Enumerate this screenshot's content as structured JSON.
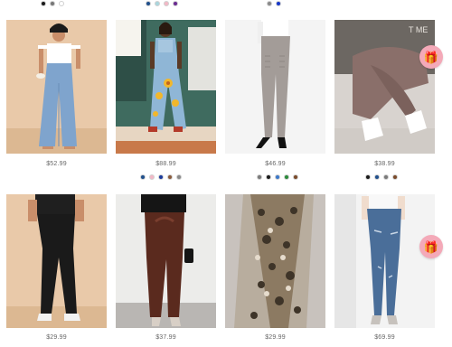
{
  "top_swatches": [
    {
      "colors": [
        "#1a1a1a",
        "#777777",
        "#ffffff"
      ]
    },
    {
      "colors": [
        "#1f4f8c",
        "#a9d6dd",
        "#f2b8c6",
        "#6a2a91"
      ]
    },
    {
      "colors": [
        "#8a8a8a",
        "#1637c9"
      ]
    }
  ],
  "products": [
    {
      "price": "$52.99",
      "swatches": []
    },
    {
      "price": "$88.99",
      "swatches": [
        "#1f4f8c",
        "#f2b8c6",
        "#1a3a9c",
        "#8a5a3a",
        "#8a8a8a"
      ]
    },
    {
      "price": "$46.99",
      "swatches": [
        "#7a7a7a",
        "#1a1a1a",
        "#3a78c9",
        "#2a8a3a",
        "#7a4a2a"
      ]
    },
    {
      "price": "$38.99",
      "swatches": [
        "#1a1a1a",
        "#1f4f8c",
        "#7a7a7a",
        "#7a4a2a"
      ]
    },
    {
      "price": "$29.99",
      "swatches": []
    },
    {
      "price": "$37.99",
      "swatches": []
    },
    {
      "price": "$29.99",
      "swatches": []
    },
    {
      "price": "$69.99",
      "swatches": []
    }
  ],
  "image_text": {
    "p4_overlay": "T ME"
  },
  "gift_icon": "gift-icon",
  "colors": {
    "gift_bg": "#f4a9b8"
  }
}
